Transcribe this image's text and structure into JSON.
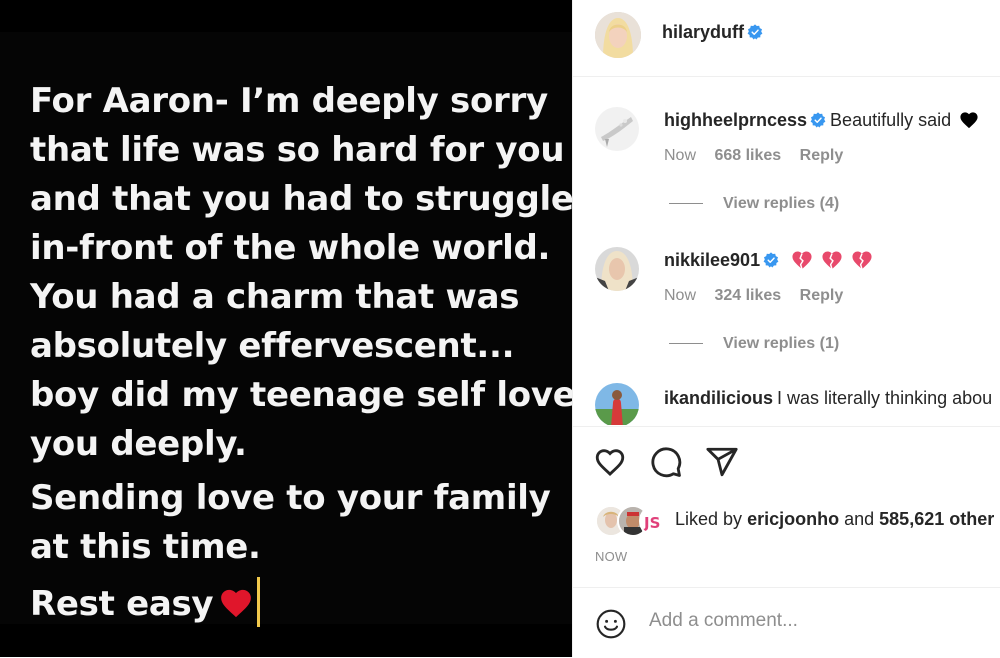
{
  "media": {
    "lines": [
      "For Aaron- I’m deeply sorry",
      "that life was so hard for you",
      "and that you had to struggle",
      "in-front of the whole world.",
      "You had a charm that was",
      "absolutely effervescent...",
      "boy did my teenage self love",
      "you deeply.",
      "Sending love to your family",
      "at this time.",
      "Rest easy"
    ]
  },
  "header": {
    "username": "hilaryduff",
    "verified": true
  },
  "comments": [
    {
      "username": "highheelprncess",
      "text": "Beautifully said",
      "time": "Now",
      "likes": "668 likes",
      "reply": "Reply",
      "view_replies": "View replies (4)"
    },
    {
      "username": "nikkilee901",
      "text": "",
      "time": "Now",
      "likes": "324 likes",
      "reply": "Reply",
      "view_replies": "View replies (1)"
    },
    {
      "username": "ikandilicious",
      "text": "I was literally thinking abou"
    }
  ],
  "likes_summary": {
    "prefix": "Liked by",
    "user": "ericjoonho",
    "connector": "and",
    "count": "585,621 other"
  },
  "post_time": "NOW",
  "comment_input": {
    "placeholder": "Add a comment..."
  },
  "colors": {
    "verified": "#3897f0",
    "heart": "#e0162b",
    "broken_heart": "#e8496b",
    "caret": "#f2c94c"
  },
  "icons": [
    "heart-outline-icon",
    "comment-icon",
    "share-icon",
    "emoji-icon",
    "verified-badge-icon"
  ]
}
